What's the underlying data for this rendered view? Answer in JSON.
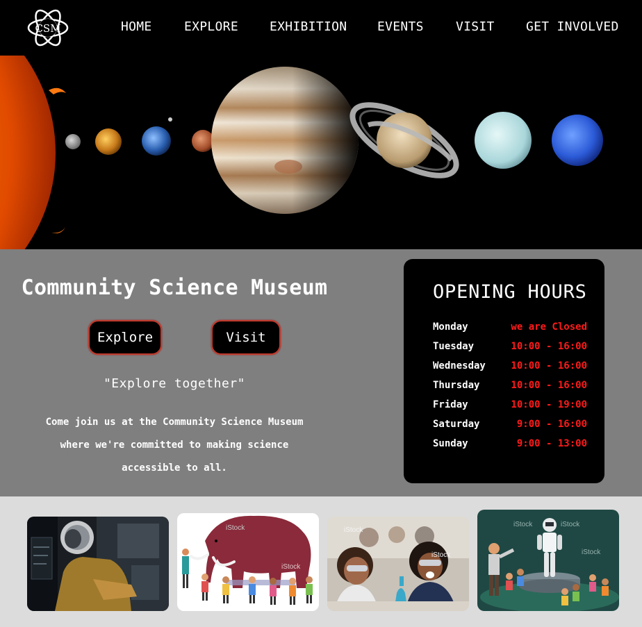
{
  "nav": {
    "logo_text": "CSM",
    "items": [
      {
        "label": "HOME"
      },
      {
        "label": "EXPLORE"
      },
      {
        "label": "EXHIBITION"
      },
      {
        "label": "EVENTS"
      },
      {
        "label": "VISIT"
      },
      {
        "label": "GET INVOLVED"
      }
    ]
  },
  "hero": {
    "bodies": [
      "sun",
      "mercury",
      "venus",
      "earth",
      "moon",
      "mars",
      "jupiter",
      "saturn",
      "uranus",
      "neptune"
    ]
  },
  "info": {
    "title": "Community Science Museum",
    "explore_label": "Explore",
    "visit_label": "Visit",
    "tagline": "\"Explore together\"",
    "description_lines": [
      "Come join us at the Community Science Museum",
      "where we're committed to making science",
      "accessible to all."
    ]
  },
  "hours": {
    "title": "OPENING HOURS",
    "rows": [
      {
        "day": "Monday",
        "time": "we are Closed"
      },
      {
        "day": "Tuesday",
        "time": "10:00 - 16:00"
      },
      {
        "day": "Wednesday",
        "time": "10:00 - 16:00"
      },
      {
        "day": "Thursday",
        "time": "10:00 - 16:00"
      },
      {
        "day": "Friday",
        "time": "10:00 - 19:00"
      },
      {
        "day": "Saturday",
        "time": " 9:00 - 16:00"
      },
      {
        "day": "Sunday",
        "time": " 9:00 - 13:00"
      }
    ]
  },
  "gallery": {
    "watermark": "iStock",
    "cards": [
      {
        "subject": "astronaut-exhibit"
      },
      {
        "subject": "mammoth-illustration"
      },
      {
        "subject": "kids-science-lab"
      },
      {
        "subject": "robot-exhibit-illustration"
      }
    ]
  },
  "colors": {
    "nav_bg": "#000000",
    "info_bg": "#7f7f7f",
    "hours_bg": "#000000",
    "hours_time": "#ff1a1a",
    "button_border": "#c0392b",
    "gallery_bg": "#dcdcdc"
  }
}
